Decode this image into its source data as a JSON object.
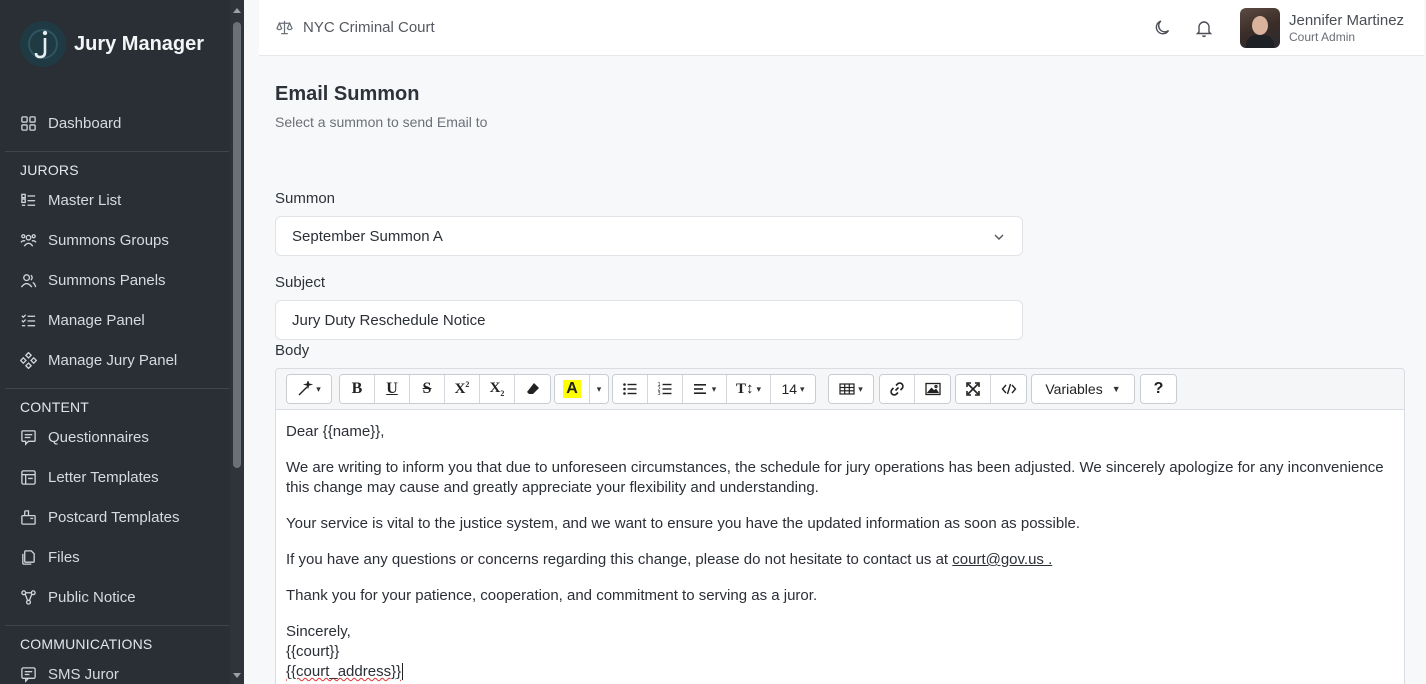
{
  "app": {
    "name": "Jury Manager",
    "logo_icon": "jury-manager-logo-icon"
  },
  "sidebar": {
    "top_items": [
      {
        "label": "Dashboard",
        "icon": "dashboard-icon"
      }
    ],
    "sections": [
      {
        "title": "JURORS",
        "items": [
          {
            "label": "Master List",
            "icon": "list-icon"
          },
          {
            "label": "Summons Groups",
            "icon": "users-group-icon"
          },
          {
            "label": "Summons Panels",
            "icon": "users-icon"
          },
          {
            "label": "Manage Panel",
            "icon": "checklist-icon"
          },
          {
            "label": "Manage Jury Panel",
            "icon": "network-icon"
          }
        ]
      },
      {
        "title": "CONTENT",
        "items": [
          {
            "label": "Questionnaires",
            "icon": "questionnaire-icon"
          },
          {
            "label": "Letter Templates",
            "icon": "template-icon"
          },
          {
            "label": "Postcard Templates",
            "icon": "postcard-icon"
          },
          {
            "label": "Files",
            "icon": "files-icon"
          },
          {
            "label": "Public Notice",
            "icon": "share-icon"
          }
        ]
      },
      {
        "title": "COMMUNICATIONS",
        "items": [
          {
            "label": "SMS Juror",
            "icon": "sms-icon"
          }
        ]
      }
    ]
  },
  "header": {
    "court_name": "NYC Criminal Court",
    "court_icon": "scale-icon",
    "theme_icon": "moon-icon",
    "notification_icon": "bell-icon",
    "user": {
      "name": "Jennifer Martinez",
      "role": "Court Admin"
    }
  },
  "main": {
    "title": "Email Summon",
    "subtitle": "Select a summon to send Email to",
    "summon": {
      "label": "Summon",
      "value": "September Summon A"
    },
    "subject": {
      "label": "Subject",
      "value": "Jury Duty Reschedule Notice"
    },
    "body": {
      "label": "Body",
      "toolbar": {
        "variables_label": "Variables",
        "help_label": "?",
        "font_size": "14"
      },
      "greeting": "Dear {{name}},",
      "paragraph_1": "We are writing to inform you that due to unforeseen circumstances, the schedule for jury operations has been adjusted. We sincerely apologize for any inconvenience this change may cause and greatly appreciate your flexibility and understanding.",
      "paragraph_2": "Your service is vital to the justice system, and we want to ensure you have the updated information as soon as possible.",
      "paragraph_3_prefix": "If you have any questions or concerns regarding this change, please do not hesitate to contact us at ",
      "contact_email": "court@gov.us .",
      "paragraph_4": "Thank you for your patience, cooperation, and commitment to serving as a juror.",
      "signoff": "Sincerely,",
      "court_var": "{{court}}",
      "court_address_var": "{{court_address}}"
    }
  }
}
